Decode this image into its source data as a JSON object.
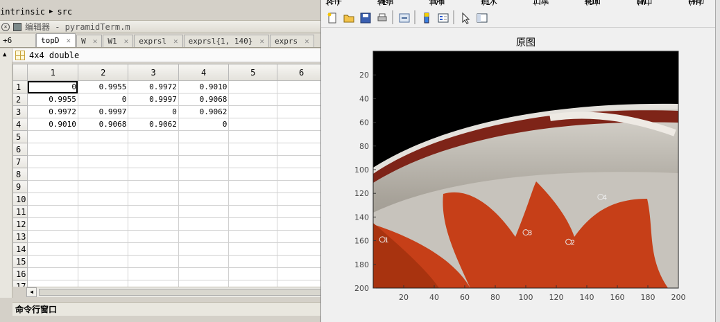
{
  "breadcrumb": {
    "part1": "intrinsic",
    "part2": "src"
  },
  "editor": {
    "title": "编辑器 - pyramidTerm.m"
  },
  "tabs": {
    "more_label": "+6",
    "items": [
      {
        "label": "topD",
        "active": true
      },
      {
        "label": "W",
        "active": false
      },
      {
        "label": "W1",
        "active": false
      },
      {
        "label": "exprsl",
        "active": false
      },
      {
        "label": "exprsl{1, 140}",
        "active": false
      },
      {
        "label": "exprs",
        "active": false
      }
    ]
  },
  "variable": {
    "size_type": "4x4 double"
  },
  "sheet": {
    "columns": [
      "1",
      "2",
      "3",
      "4",
      "5",
      "6"
    ],
    "rows": [
      {
        "label": "1",
        "cells": [
          "0",
          "0.9955",
          "0.9972",
          "0.9010",
          "",
          ""
        ]
      },
      {
        "label": "2",
        "cells": [
          "0.9955",
          "0",
          "0.9997",
          "0.9068",
          "",
          ""
        ]
      },
      {
        "label": "3",
        "cells": [
          "0.9972",
          "0.9997",
          "0",
          "0.9062",
          "",
          ""
        ]
      },
      {
        "label": "4",
        "cells": [
          "0.9010",
          "0.9068",
          "0.9062",
          "0",
          "",
          ""
        ]
      },
      {
        "label": "5",
        "cells": [
          "",
          "",
          "",
          "",
          "",
          ""
        ]
      },
      {
        "label": "6",
        "cells": [
          "",
          "",
          "",
          "",
          "",
          ""
        ]
      },
      {
        "label": "7",
        "cells": [
          "",
          "",
          "",
          "",
          "",
          ""
        ]
      },
      {
        "label": "8",
        "cells": [
          "",
          "",
          "",
          "",
          "",
          ""
        ]
      },
      {
        "label": "9",
        "cells": [
          "",
          "",
          "",
          "",
          "",
          ""
        ]
      },
      {
        "label": "10",
        "cells": [
          "",
          "",
          "",
          "",
          "",
          ""
        ]
      },
      {
        "label": "11",
        "cells": [
          "",
          "",
          "",
          "",
          "",
          ""
        ]
      },
      {
        "label": "12",
        "cells": [
          "",
          "",
          "",
          "",
          "",
          ""
        ]
      },
      {
        "label": "13",
        "cells": [
          "",
          "",
          "",
          "",
          "",
          ""
        ]
      },
      {
        "label": "14",
        "cells": [
          "",
          "",
          "",
          "",
          "",
          ""
        ]
      },
      {
        "label": "15",
        "cells": [
          "",
          "",
          "",
          "",
          "",
          ""
        ]
      },
      {
        "label": "16",
        "cells": [
          "",
          "",
          "",
          "",
          "",
          ""
        ]
      },
      {
        "label": "17",
        "cells": [
          "",
          "",
          "",
          "",
          "",
          ""
        ]
      }
    ]
  },
  "command_window": {
    "title": "命令行窗口"
  },
  "figure": {
    "menus": [
      "文件(F)",
      "编辑(E)",
      "查看(V)",
      "插入(I)",
      "工具(T)",
      "桌面(D)",
      "窗口(W)",
      "帮助(H)"
    ],
    "toolbar_icons": [
      "new-figure-icon",
      "open-icon",
      "save-icon",
      "print-icon",
      "link-icon",
      "colorbar-icon",
      "legend-icon",
      "pointer-icon",
      "property-editor-icon"
    ],
    "axes_title": "原图",
    "x_ticks": [
      "20",
      "40",
      "60",
      "80",
      "100",
      "120",
      "140",
      "160",
      "180",
      "200"
    ],
    "y_ticks": [
      "20",
      "40",
      "60",
      "80",
      "100",
      "120",
      "140",
      "160",
      "180",
      "200"
    ],
    "markers": [
      {
        "label": "1",
        "x": 6,
        "y": 159
      },
      {
        "label": "2",
        "x": 128,
        "y": 161
      },
      {
        "label": "3",
        "x": 100,
        "y": 153
      },
      {
        "label": "4",
        "x": 149,
        "y": 123
      }
    ],
    "colors": {
      "background": "#000000",
      "plate": "#b9b4ab",
      "rim": "#7e2418",
      "petal": "#c63f18"
    }
  }
}
